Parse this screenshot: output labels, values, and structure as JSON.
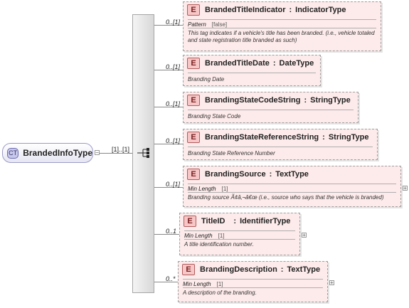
{
  "complex_type": {
    "badge": "CT",
    "name": "BrandedInfoType"
  },
  "sequence": {
    "cardinality": "[1]..[1]"
  },
  "elements": [
    {
      "name": "BrandedTitleIndicator",
      "type": "IndicatorType",
      "cardinality": "0..[1]",
      "facet_label": "Pattern",
      "facet_value": "[false]",
      "documentation": "This tag indicates if a vehicle's title has been branded. (i.e., vehicle totaled and state registration title branded as such)"
    },
    {
      "name": "BrandedTitleDate",
      "type": "DateType",
      "cardinality": "0..[1]",
      "facet_label": "",
      "facet_value": "",
      "documentation": "Branding Date"
    },
    {
      "name": "BrandingStateCodeString",
      "type": "StringType",
      "cardinality": "0..[1]",
      "facet_label": "",
      "facet_value": "",
      "documentation": "Branding State Code"
    },
    {
      "name": "BrandingStateReferenceString",
      "type": "StringType",
      "cardinality": "0..[1]",
      "facet_label": "",
      "facet_value": "",
      "documentation": "Branding State Reference Number"
    },
    {
      "name": "BrandingSource",
      "type": "TextType",
      "cardinality": "0..[1]",
      "facet_label": "Min Length",
      "facet_value": "[1]",
      "documentation": "Branding source Ã¢â‚¬â€œ (i.e., source who says that the vehicle is branded)"
    },
    {
      "name": "TitleID",
      "type": "IdentifierType",
      "cardinality": "0..1",
      "facet_label": "Min Length",
      "facet_value": "[1]",
      "documentation": "A title identification number."
    },
    {
      "name": "BrandingDescription",
      "type": "TextType",
      "cardinality": "0..*",
      "facet_label": "Min Length",
      "facet_value": "[1]",
      "documentation": "A description of the branding."
    }
  ],
  "ui": {
    "expand_symbol": "+",
    "collapse_symbol": "−",
    "element_badge": "E",
    "type_separator": ":"
  }
}
